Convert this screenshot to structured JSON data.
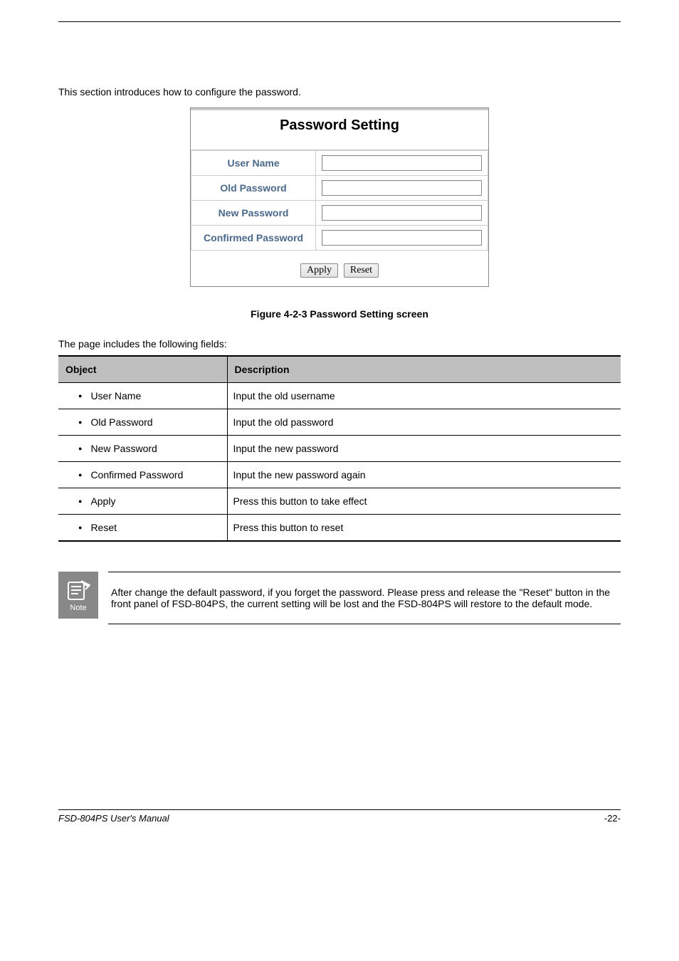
{
  "intro_text": "This section introduces how to configure the password.",
  "form": {
    "title": "Password Setting",
    "labels": {
      "username": "User Name",
      "old_password": "Old Password",
      "new_password": "New Password",
      "confirmed_password": "Confirmed Password"
    },
    "values": {
      "username": "",
      "old_password": "",
      "new_password": "",
      "confirmed_password": ""
    },
    "buttons": {
      "apply": "Apply",
      "reset": "Reset"
    }
  },
  "figure_caption": "Figure 4-2-3 Password Setting screen",
  "table_intro": "The page includes the following fields:",
  "table": {
    "headers": {
      "object": "Object",
      "description": "Description"
    },
    "rows": [
      {
        "object": "User Name",
        "description": "Input the old username"
      },
      {
        "object": "Old Password",
        "description": "Input the old password"
      },
      {
        "object": "New Password",
        "description": "Input the new password"
      },
      {
        "object": "Confirmed Password",
        "description": "Input the new password again"
      },
      {
        "object": "Apply",
        "description": "Press this button to take effect"
      },
      {
        "object": "Reset",
        "description": "Press this button to reset"
      }
    ]
  },
  "note": {
    "icon_label": "Note",
    "text": "After change the default password, if you forget the password. Please press and release the \"Reset\" button in the front panel of FSD-804PS, the current setting will be lost and the FSD-804PS will restore to the default mode."
  },
  "footer": {
    "product": "FSD-804PS User's Manual",
    "page": "-22-"
  }
}
